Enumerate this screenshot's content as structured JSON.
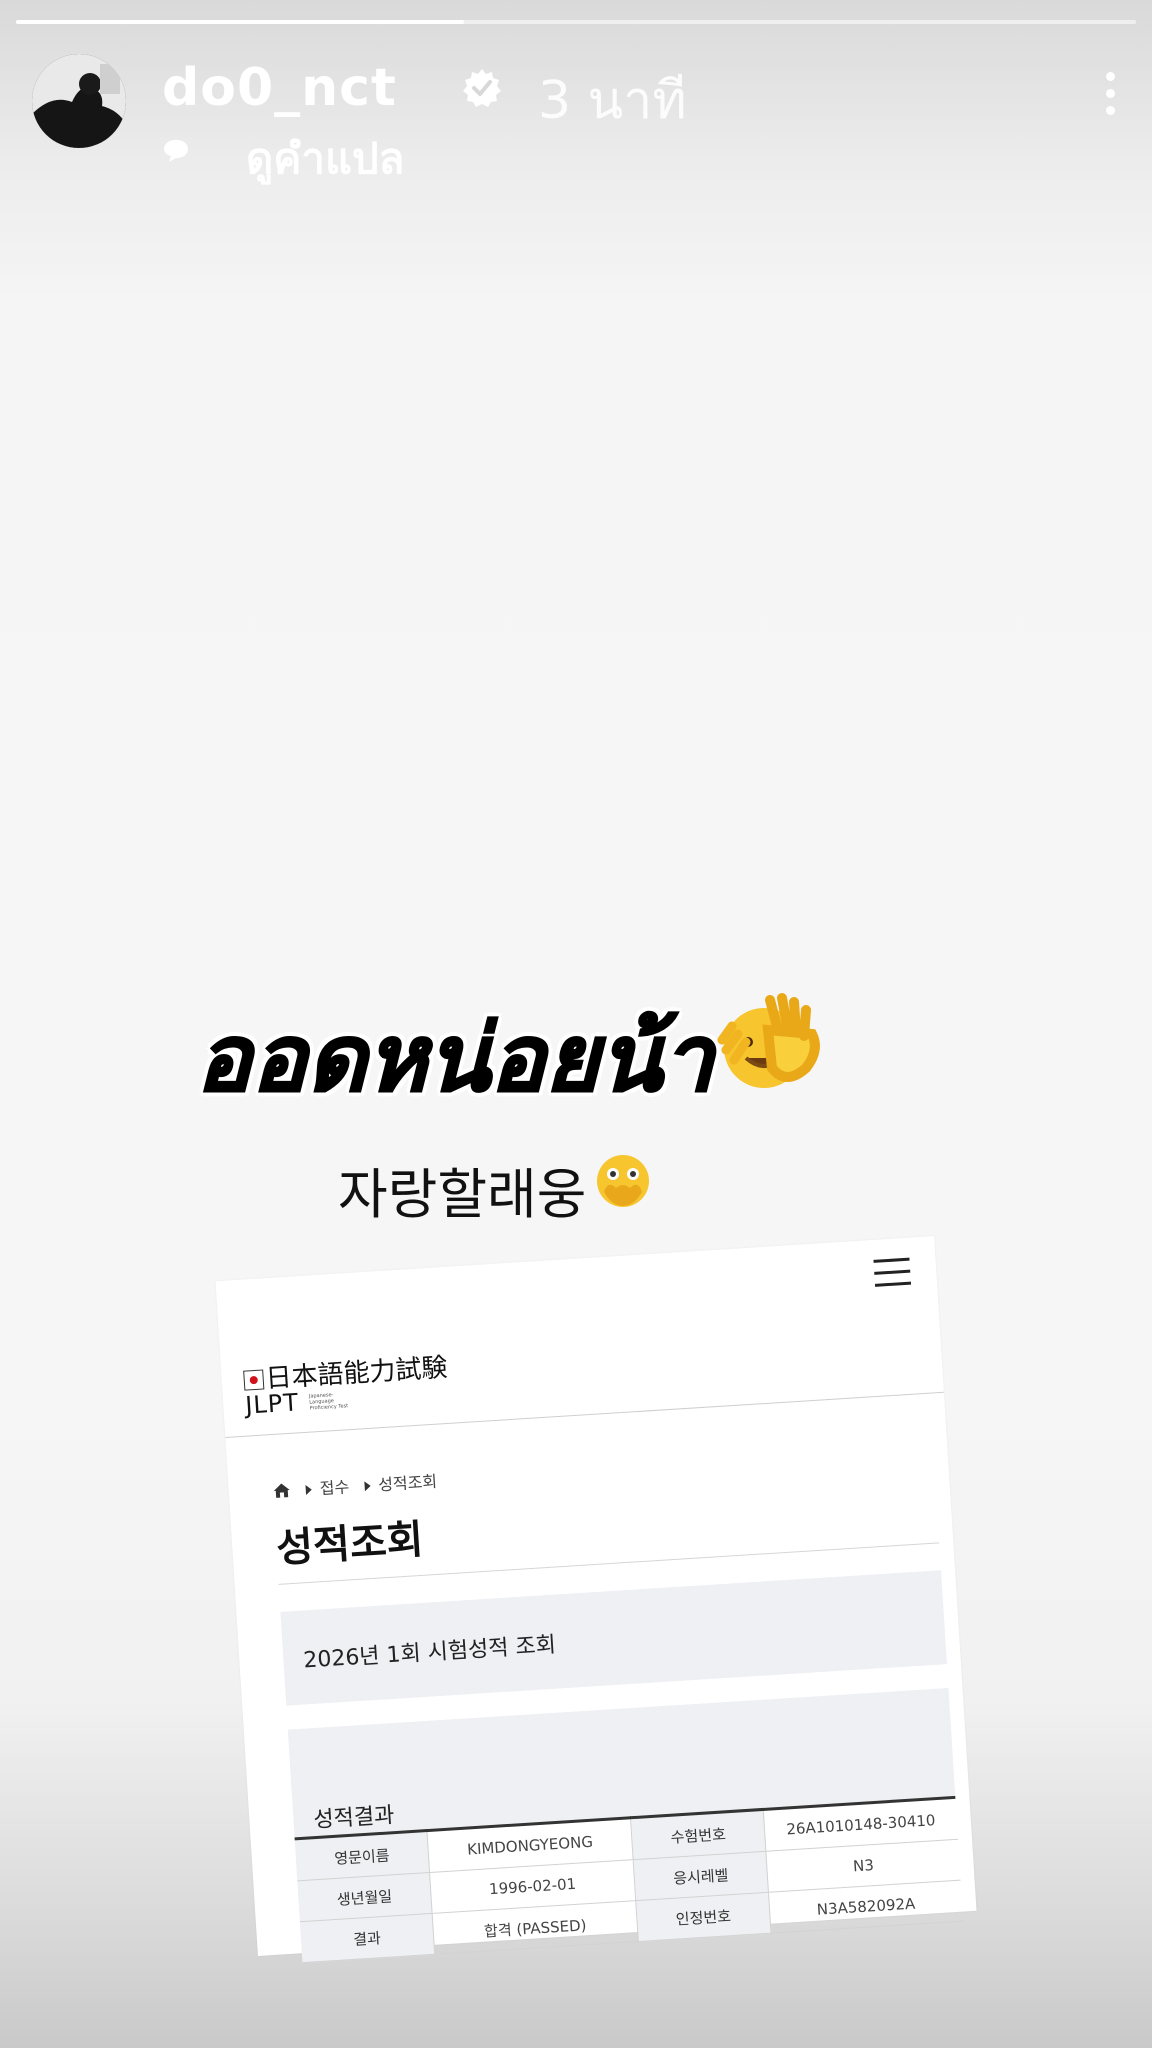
{
  "story": {
    "progress_fraction": 0.4,
    "username": "do0_nct",
    "verified_icon": "verified-badge-icon",
    "time_ago": "3 นาที",
    "translate_label": "ดูคำแปล",
    "menu_icon": "more-vertical-icon"
  },
  "sticker": {
    "text": "ออดหน่อยน้า",
    "emoji": "face-with-peeking-eye"
  },
  "caption": {
    "text": "자랑할래웅",
    "emoji": "face-with-open-eyes-and-hand-over-mouth"
  },
  "document": {
    "logo_jp": "日本語能力試験",
    "logo_en": "JLPT",
    "logo_sub": "Japanese-Language Proficiency Test",
    "breadcrumb": [
      "접수",
      "성적조회"
    ],
    "title": "성적조회",
    "exam_section": "2026년 1회 시험성적 조회",
    "result_section": "성적결과",
    "rows": [
      {
        "label1": "영문이름",
        "value1": "KIMDONGYEONG",
        "label2": "수험번호",
        "value2": "26A1010148-30410"
      },
      {
        "label1": "생년월일",
        "value1": "1996-02-01",
        "label2": "응시레벨",
        "value2": "N3"
      },
      {
        "label1": "결과",
        "value1": "합격 (PASSED)",
        "label2": "인정번호",
        "value2": "N3A582092A"
      }
    ]
  }
}
